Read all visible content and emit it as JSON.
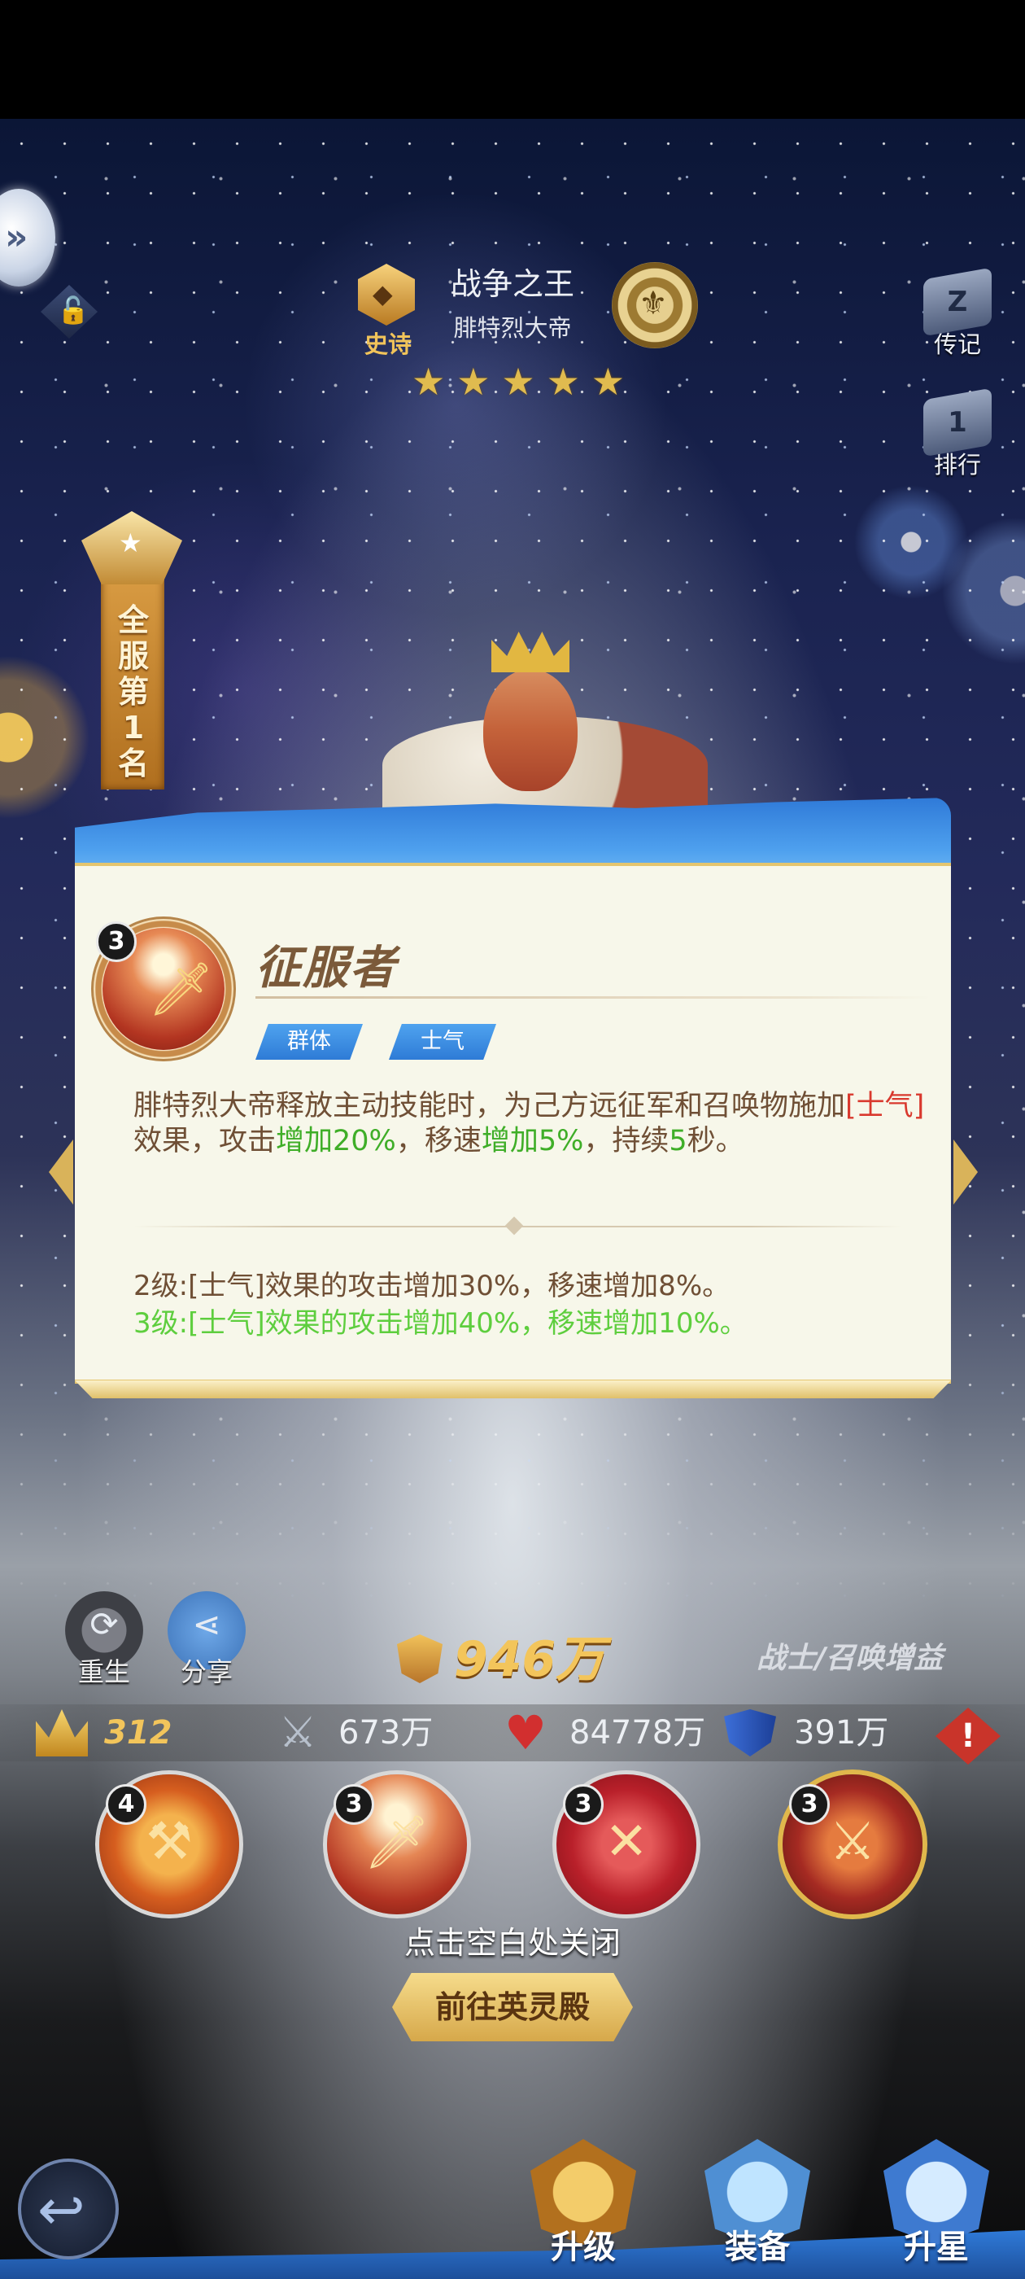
{
  "header": {
    "rarity_label": "史诗",
    "hero_title": "战争之王",
    "hero_name": "腓特烈大帝",
    "star_count": 5,
    "stars": [
      "★",
      "★",
      "★",
      "★",
      "★"
    ],
    "side_buttons": {
      "biography": "传记",
      "ranking": "排行",
      "ranking_number": "1"
    },
    "rank_banner": "全服第1名"
  },
  "skill_popup": {
    "level": "3",
    "name": "征服者",
    "tags": [
      "群体",
      "士气"
    ],
    "description": {
      "part1": "腓特烈大帝释放主动技能时，为己方远征军和召唤物施加",
      "effect": "[士气]",
      "part2": "效果，攻击",
      "bonus1": "增加20%",
      "part3": "，移速",
      "bonus2": "增加5%",
      "part4": "，持续",
      "duration": "5",
      "part5": "秒。"
    },
    "level2": "2级:[士气]效果的攻击增加30%，移速增加8%。",
    "level3": "3级:[士气]效果的攻击增加40%，移速增加10%。"
  },
  "actions": {
    "rebirth": "重生",
    "share": "分享"
  },
  "power": "946万",
  "hero_class": "战士/召唤增益",
  "stats": {
    "level": "312",
    "attack": "673万",
    "health": "84778万",
    "defense": "391万"
  },
  "skill_slots": [
    {
      "level": "4"
    },
    {
      "level": "3"
    },
    {
      "level": "3"
    },
    {
      "level": "3"
    }
  ],
  "close_hint": "点击空白处关闭",
  "goto_button": "前往英灵殿",
  "bottom_nav": {
    "upgrade": "升级",
    "equip": "装备",
    "star_up": "升星"
  },
  "colors": {
    "gold": "#f3c55b",
    "panel_blue": "#3a8be0",
    "panel_bg": "#f7f7ea",
    "text_brown": "#6f4f35",
    "effect_red": "#d9392e",
    "bonus_green": "#3fae28",
    "level3_green": "#5ece3e"
  },
  "icons": [
    "collapse-icon",
    "lock-icon",
    "epic-icon",
    "emblem-icon",
    "biography-icon",
    "ranking-icon",
    "rebirth-icon",
    "share-icon",
    "power-icon",
    "crown-icon",
    "sword-icon",
    "heart-icon",
    "shield-icon",
    "warning-icon",
    "back-icon"
  ]
}
